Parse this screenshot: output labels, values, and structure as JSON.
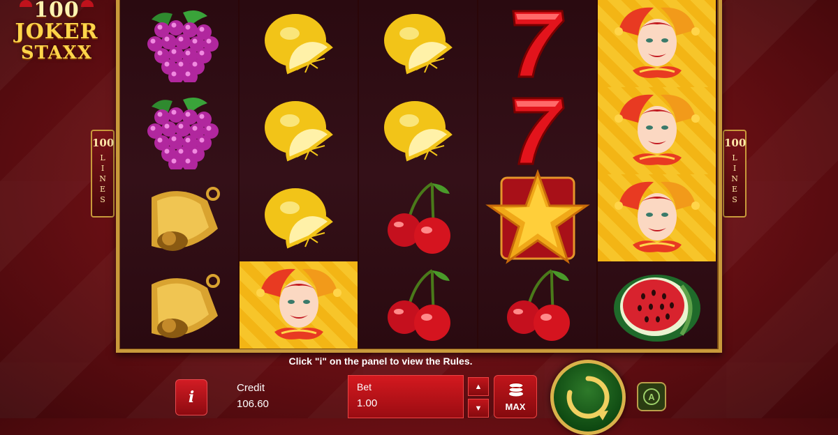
{
  "game": {
    "logo_line1": "100",
    "logo_line2": "JOKER",
    "logo_line3": "STAXX"
  },
  "lines_badge": {
    "number": "100",
    "label": "LINES"
  },
  "reels": [
    [
      "grapes",
      "grapes",
      "bell",
      "bell"
    ],
    [
      "lemon",
      "lemon",
      "lemon",
      "joker"
    ],
    [
      "lemon",
      "lemon",
      "cherry",
      "cherry"
    ],
    [
      "seven",
      "seven",
      "star",
      "cherry"
    ],
    [
      "joker",
      "joker",
      "joker",
      "watermelon"
    ]
  ],
  "hint": "Click \"i\" on the panel to view the Rules.",
  "panel": {
    "info_icon": "i",
    "credit_label": "Credit",
    "credit_value": "106.60",
    "bet_label": "Bet",
    "bet_value": "1.00",
    "max_label": "MAX",
    "auto_icon": "A"
  }
}
